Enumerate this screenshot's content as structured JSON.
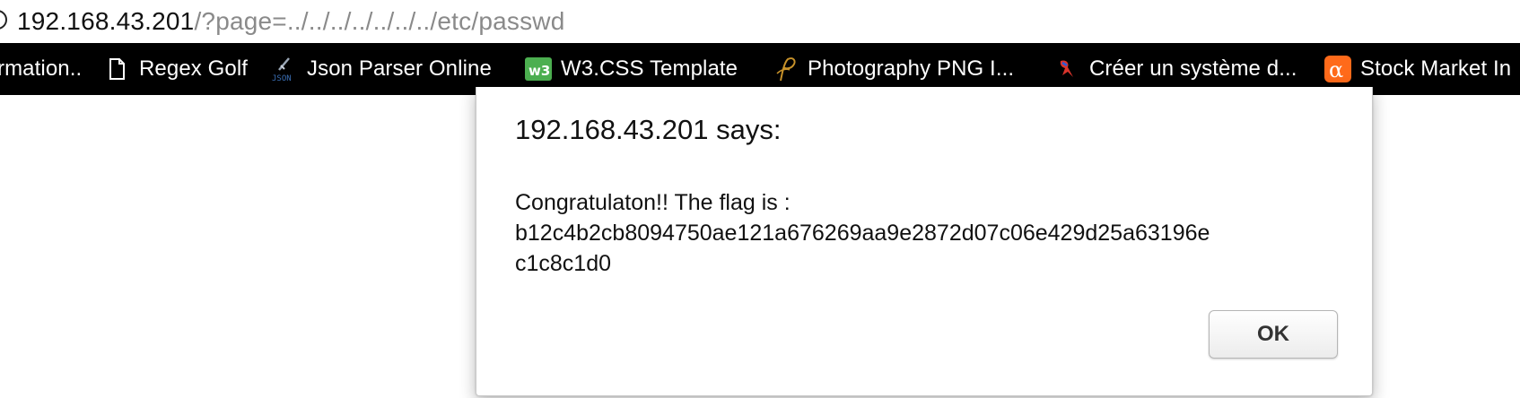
{
  "address_bar": {
    "host": "192.168.43.201",
    "path": "/?page=../../../../../../../etc/passwd"
  },
  "bookmarks": [
    {
      "label": "rmation..",
      "icon": ""
    },
    {
      "label": "Regex Golf",
      "icon": "document-icon"
    },
    {
      "label": "Json Parser Online",
      "icon": "json-icon"
    },
    {
      "label": "W3.CSS Template",
      "icon": "w3-icon"
    },
    {
      "label": "Photography PNG I...",
      "icon": "photography-p-icon"
    },
    {
      "label": "Créer un système d...",
      "icon": "bird-icon"
    },
    {
      "label": "Stock Market In",
      "icon": "alpha-icon"
    }
  ],
  "dialog": {
    "title": "192.168.43.201 says:",
    "message_line1": "Congratulaton!! The flag is :",
    "message_line2": "b12c4b2cb8094750ae121a676269aa9e2872d07c06e429d25a63196e",
    "message_line3": "c1c8c1d0",
    "ok_label": "OK"
  },
  "colors": {
    "bookmark_bar_bg": "#000000",
    "w3_icon": "#4caf50",
    "alpha_icon": "#ff6a1a",
    "photography_icon": "#c8922a"
  }
}
